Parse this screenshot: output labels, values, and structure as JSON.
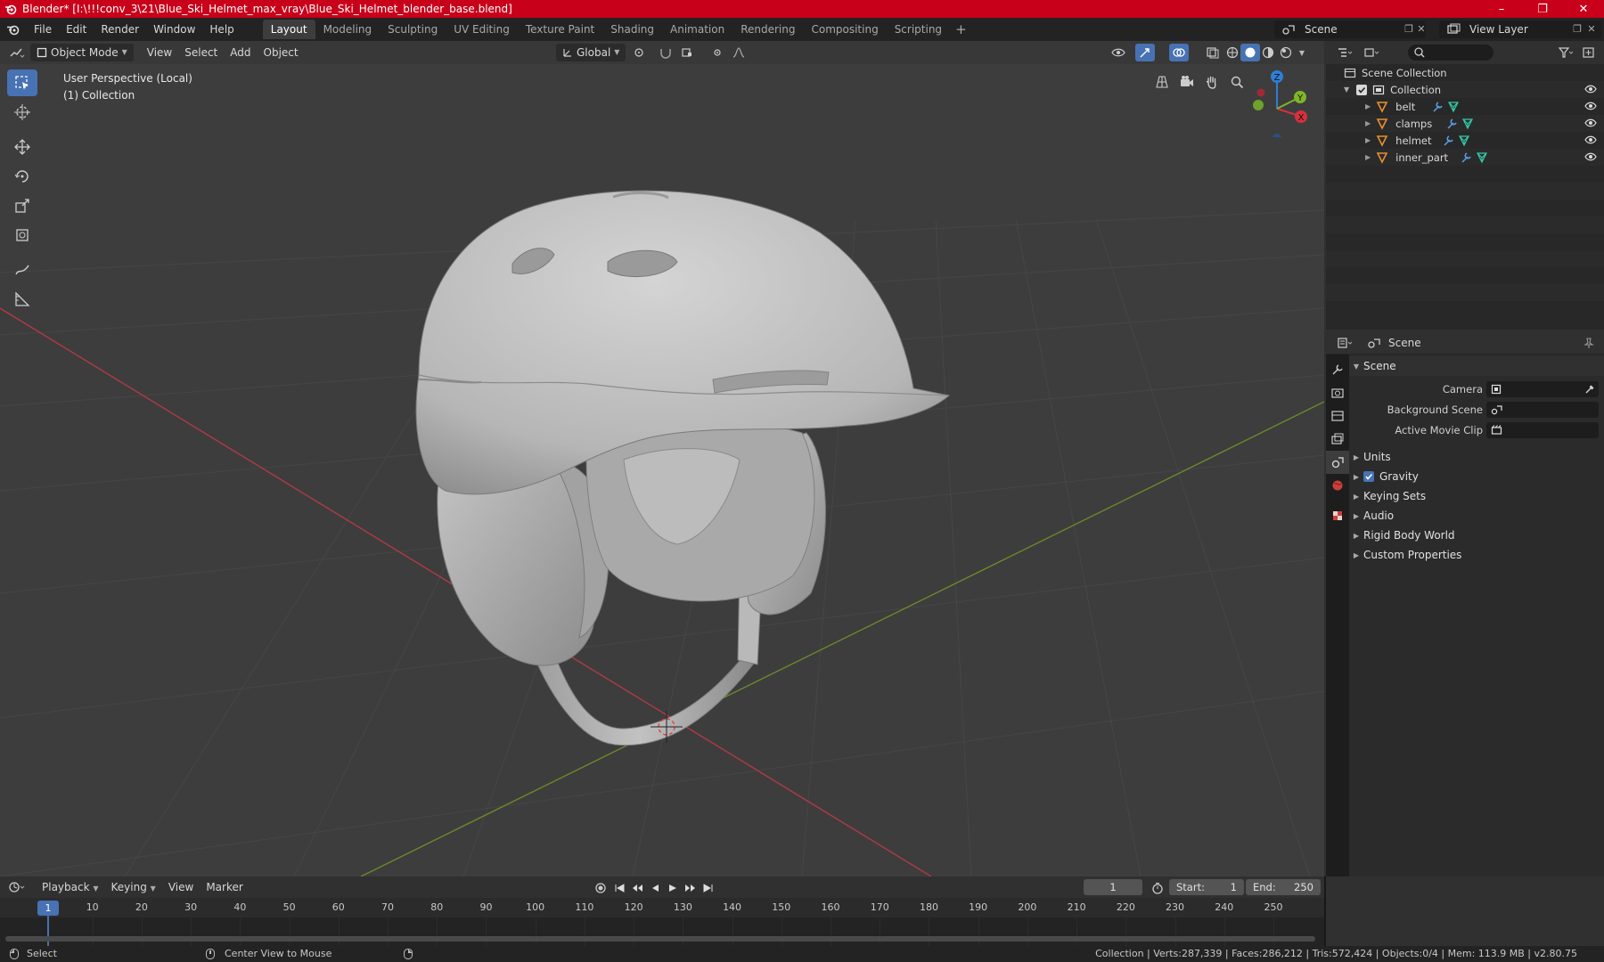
{
  "window": {
    "title": "Blender* [I:\\!!!conv_3\\21\\Blue_Ski_Helmet_max_vray\\Blue_Ski_Helmet_blender_base.blend]",
    "controls": [
      "–",
      "❐",
      "✕"
    ]
  },
  "menubar": {
    "items": [
      "File",
      "Edit",
      "Render",
      "Window",
      "Help"
    ],
    "workspaces": [
      "Layout",
      "Modeling",
      "Sculpting",
      "UV Editing",
      "Texture Paint",
      "Shading",
      "Animation",
      "Rendering",
      "Compositing",
      "Scripting"
    ],
    "active_workspace": "Layout",
    "add_tab": "+",
    "scene": "Scene",
    "view_layer": "View Layer"
  },
  "viewport": {
    "mode": "Object Mode",
    "menus": [
      "View",
      "Select",
      "Add",
      "Object"
    ],
    "transform_orientation": "Global",
    "info_line1": "User Perspective (Local)",
    "info_line2": "(1) Collection",
    "axes": {
      "x": "X",
      "y": "Y",
      "z": "Z"
    }
  },
  "outliner": {
    "root": "Scene Collection",
    "collection": "Collection",
    "objects": [
      "belt",
      "clamps",
      "helmet",
      "inner_part"
    ]
  },
  "properties": {
    "context": "Scene",
    "panel_title": "Scene",
    "fields": [
      {
        "label": "Camera"
      },
      {
        "label": "Background Scene"
      },
      {
        "label": "Active Movie Clip"
      }
    ],
    "subpanels": [
      "Units",
      "Gravity",
      "Keying Sets",
      "Audio",
      "Rigid Body World",
      "Custom Properties"
    ],
    "gravity_checked": true
  },
  "timeline": {
    "menus": [
      "Playback",
      "Keying",
      "View",
      "Marker"
    ],
    "current_frame": "1",
    "frame_field": "1",
    "start_label": "Start:",
    "start": "1",
    "end_label": "End:",
    "end": "250",
    "ticks": [
      "1",
      "10",
      "20",
      "30",
      "40",
      "50",
      "60",
      "70",
      "80",
      "90",
      "100",
      "110",
      "120",
      "130",
      "140",
      "150",
      "160",
      "170",
      "180",
      "190",
      "200",
      "210",
      "220",
      "230",
      "240",
      "250"
    ]
  },
  "statusbar": {
    "left": "Select",
    "middle": "Center View to Mouse",
    "right": "Collection | Verts:287,339 | Faces:286,212 | Tris:572,424 | Objects:0/4 | Mem: 113.9 MB | v2.80.75"
  },
  "colors": {
    "title_bar": "#c8001a",
    "accent": "#4772b3",
    "viewport_bg": "#3d3d3d",
    "axis_x": "#d7303e",
    "axis_y": "#7fb627",
    "axis_z": "#2e7fd6",
    "object_icon": "#e8902f",
    "mesh_icon": "#33c9a7"
  }
}
